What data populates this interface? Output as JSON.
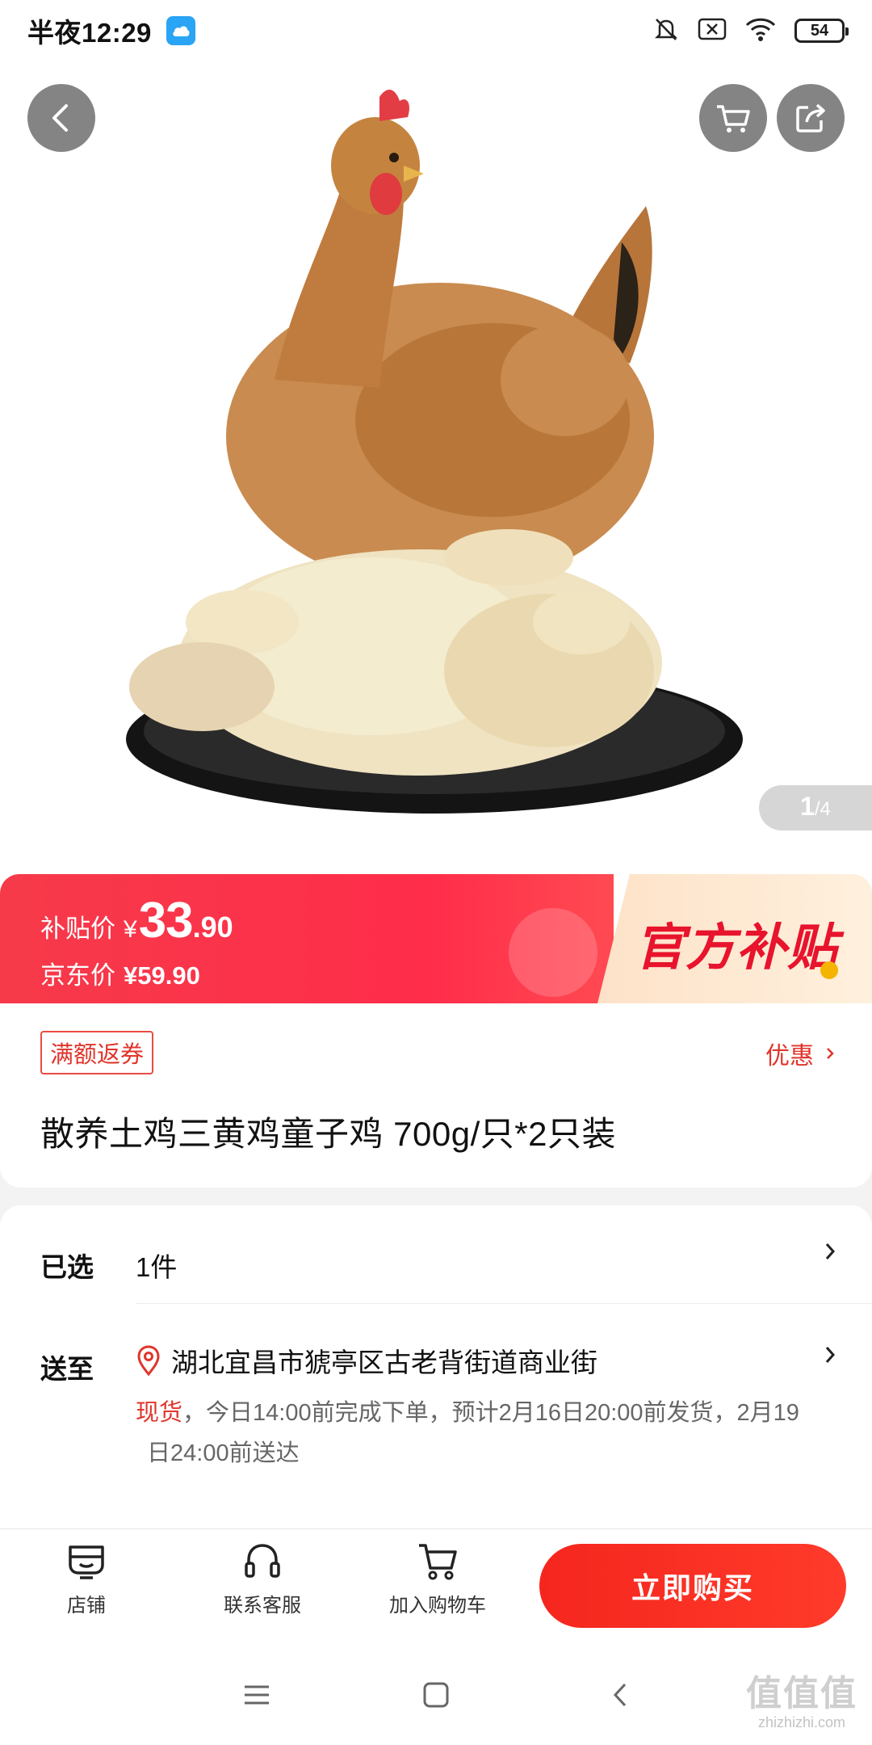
{
  "status_bar": {
    "time": "半夜12:29",
    "battery": "54"
  },
  "gallery": {
    "current": "1",
    "total": "/4"
  },
  "price": {
    "subsidy_label": "补贴价",
    "currency": "¥",
    "subsidy_int": "33",
    "subsidy_dec": ".90",
    "jd_label": "京东价",
    "jd_price": "¥59.90",
    "official_tag": "官方补贴"
  },
  "product": {
    "coupon_tag": "满额返券",
    "discount_link": "优惠",
    "title": "散养土鸡三黄鸡童子鸡 700g/只*2只装"
  },
  "options": {
    "selected_label": "已选",
    "selected_value": "1件",
    "deliver_label": "送至",
    "address": "湖北宜昌市猇亭区古老背街道商业街",
    "in_stock": "现货",
    "shipping_info_line1": "，今日14:00前完成下单，预计2月16日20:00前发货，2月19",
    "shipping_info_line2": "日24:00前送达"
  },
  "bottom_bar": {
    "store_label": "店铺",
    "service_label": "联系客服",
    "cart_label": "加入购物车",
    "buy_label": "立即购买"
  },
  "watermark": {
    "main": "值值值",
    "sub": "zhizhizhi.com"
  },
  "colors": {
    "accent_red": "#ff2d4a",
    "buy_red": "#f5261e",
    "subsidy_gold": "#fde2c8"
  }
}
